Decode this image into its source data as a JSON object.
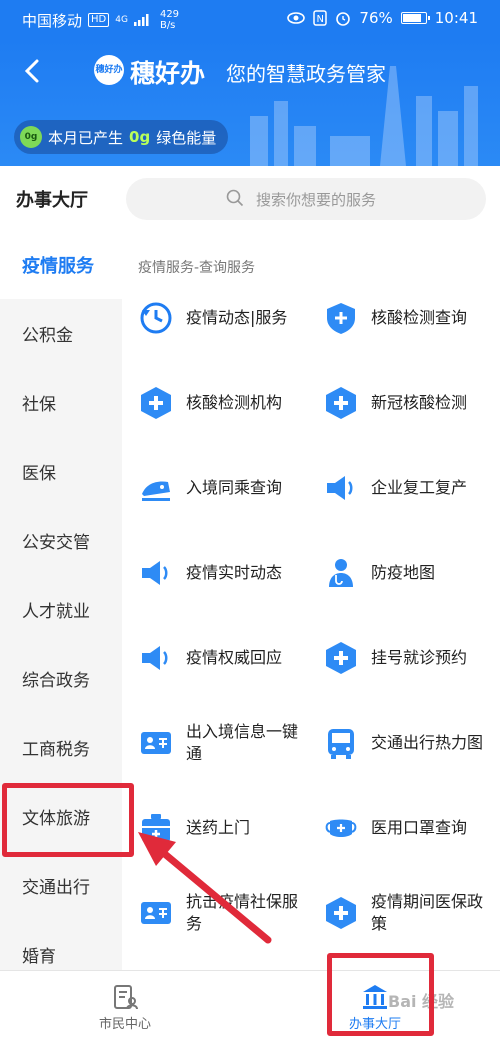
{
  "status_bar": {
    "carrier": "中国移动",
    "hd": "HD",
    "signal": "4G",
    "speed_value": "429",
    "speed_unit": "B/s",
    "battery": "76%",
    "time": "10:41"
  },
  "header": {
    "back_icon": "chevron-left-icon",
    "logo_text": "穗好办",
    "app_name": "穗好办",
    "slogan": "您的智慧政务管家",
    "energy_prefix": "本月已产生",
    "energy_value": "0g",
    "energy_suffix": "绿色能量",
    "leaf_text": "0g"
  },
  "search": {
    "hall_title": "办事大厅",
    "placeholder": "搜索你想要的服务"
  },
  "sidebar": {
    "items": [
      {
        "label": "疫情服务",
        "active": true
      },
      {
        "label": "公积金"
      },
      {
        "label": "社保"
      },
      {
        "label": "医保"
      },
      {
        "label": "公安交管"
      },
      {
        "label": "人才就业"
      },
      {
        "label": "综合政务"
      },
      {
        "label": "工商税务"
      },
      {
        "label": "文体旅游"
      },
      {
        "label": "交通出行"
      },
      {
        "label": "婚育"
      }
    ]
  },
  "content": {
    "section_title": "疫情服务-查询服务",
    "services": [
      {
        "label": "疫情动态|服务",
        "icon": "clock-refresh-icon"
      },
      {
        "label": "核酸检测查询",
        "icon": "shield-plus-icon"
      },
      {
        "label": "核酸检测机构",
        "icon": "medical-cross-icon"
      },
      {
        "label": "新冠核酸检测",
        "icon": "medical-cross-icon"
      },
      {
        "label": "入境同乘查询",
        "icon": "train-icon"
      },
      {
        "label": "企业复工复产",
        "icon": "megaphone-icon"
      },
      {
        "label": "疫情实时动态",
        "icon": "megaphone-icon"
      },
      {
        "label": "防疫地图",
        "icon": "doctor-icon"
      },
      {
        "label": "疫情权威回应",
        "icon": "megaphone-icon"
      },
      {
        "label": "挂号就诊预约",
        "icon": "medical-cross-icon"
      },
      {
        "label": "出入境信息一键通",
        "icon": "id-card-icon"
      },
      {
        "label": "交通出行热力图",
        "icon": "bus-icon"
      },
      {
        "label": "送药上门",
        "icon": "medicine-box-icon"
      },
      {
        "label": "医用口罩查询",
        "icon": "mask-icon"
      },
      {
        "label": "抗击疫情社保服务",
        "icon": "id-card-icon"
      },
      {
        "label": "疫情期间医保政策",
        "icon": "medical-cross-icon"
      }
    ]
  },
  "bottom_nav": {
    "items": [
      {
        "label": "市民中心",
        "icon": "citizen-card-icon"
      },
      {
        "label": "办事大厅",
        "icon": "government-building-icon",
        "active": true
      }
    ]
  },
  "watermark": "Bai 经验",
  "colors": {
    "brand_blue": "#1e7cf2",
    "highlight_red": "#e02a3a",
    "energy_green": "#b8ff5a"
  }
}
